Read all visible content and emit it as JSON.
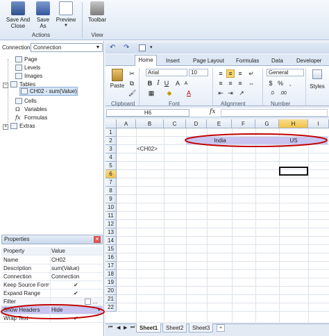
{
  "toolbar": {
    "save_close": "Save And\nClose",
    "save_as": "Save\nAs",
    "preview": "Preview",
    "toolbar_btn": "Toolbar",
    "group_actions": "Actions",
    "group_view": "View"
  },
  "connection": {
    "label": "Connection",
    "value": "Connection"
  },
  "tree": {
    "items": [
      {
        "label": "Page"
      },
      {
        "label": "Levels"
      },
      {
        "label": "Images"
      },
      {
        "label": "Tables"
      },
      {
        "label": "CH02 - sum(Value)"
      },
      {
        "label": "Cells"
      },
      {
        "label": "Variables"
      },
      {
        "label": "Formulas"
      },
      {
        "label": "Extras"
      }
    ]
  },
  "properties": {
    "title": "Properties",
    "close": "✕",
    "header": {
      "name": "Property",
      "value": "Value"
    },
    "rows": [
      {
        "name": "Name",
        "value": "CH02"
      },
      {
        "name": "Description",
        "value": "sum(Value)"
      },
      {
        "name": "Connection",
        "value": "Connection"
      },
      {
        "name": "Keep Source Formatting",
        "value": "✔"
      },
      {
        "name": "Expand Range",
        "value": "✔"
      },
      {
        "name": "Filter",
        "value": ""
      },
      {
        "name": "Show Headers",
        "value": "Hide"
      },
      {
        "name": "Wrap Text",
        "value": "✔"
      }
    ]
  },
  "excel": {
    "tabs": [
      "Home",
      "Insert",
      "Page Layout",
      "Formulas",
      "Data",
      "Developer"
    ],
    "font_name": "Arial",
    "font_size": "10",
    "number_format": "General",
    "paste_label": "Paste",
    "styles_label": "Styles",
    "groups": [
      "Clipboard",
      "Font",
      "Alignment",
      "Number"
    ],
    "namebox": "H6",
    "fx": "fx",
    "columns": [
      "A",
      "B",
      "C",
      "D",
      "E",
      "F",
      "G",
      "H",
      "I"
    ],
    "rows": [
      "1",
      "2",
      "3",
      "4",
      "5",
      "6",
      "7",
      "8",
      "9",
      "10",
      "11",
      "12",
      "13",
      "14",
      "15",
      "16",
      "17",
      "18",
      "19",
      "20",
      "21",
      "22"
    ],
    "cells": {
      "india": "India",
      "us": "US",
      "ch02": "<CH02>"
    },
    "sheets": [
      "Sheet1",
      "Sheet2",
      "Sheet3"
    ]
  },
  "colors": {
    "highlight_ellipse": "#c00000",
    "selection_fill": "#c9c5f0"
  }
}
